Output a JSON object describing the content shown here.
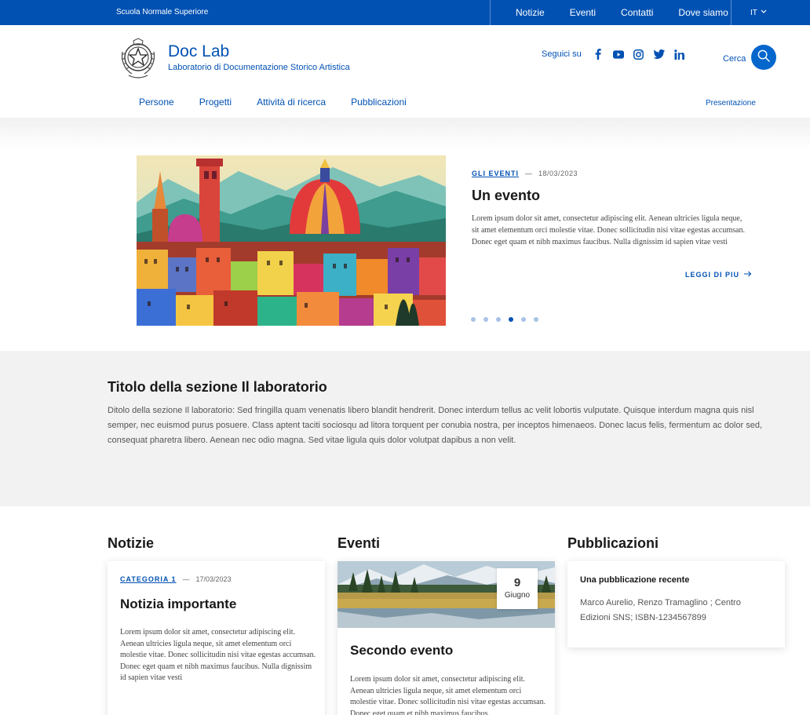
{
  "slim_header": {
    "org_name": "Scuola Normale Superiore",
    "links": [
      "Notizie",
      "Eventi",
      "Contatti",
      "Dove siamo"
    ],
    "language": "IT"
  },
  "brand": {
    "title": "Doc Lab",
    "subtitle": "Laboratorio di Documentazione Storico Artistica"
  },
  "social": {
    "label": "Seguici su",
    "icons": [
      "facebook-icon",
      "youtube-icon",
      "instagram-icon",
      "twitter-icon",
      "linkedin-icon"
    ]
  },
  "search": {
    "label": "Cerca"
  },
  "main_nav": {
    "items": [
      "Persone",
      "Progetti",
      "Attività di ricerca",
      "Pubblicazioni"
    ],
    "secondary": "Presentazione"
  },
  "hero": {
    "category": "GLI EVENTI",
    "date": "18/03/2023",
    "title": "Un evento",
    "text": "Lorem ipsum dolor sit amet, consectetur adipiscing elit. Aenean ultricies ligula neque, sit amet elementum orci molestie vitae. Donec sollicitudin nisi vitae egestas accumsan. Donec eget quam et nibh maximus faucibus. Nulla dignissim id sapien vitae vesti",
    "read_more": "LEGGI DI PIU",
    "slide_count": 6,
    "active_slide": 4
  },
  "section": {
    "title": "Titolo della sezione Il laboratorio",
    "text": "Ditolo della sezione Il laboratorio: Sed fringilla quam venenatis libero blandit hendrerit. Donec interdum tellus ac velit lobortis vulputate. Quisque interdum magna quis nisl semper, nec euismod purus posuere. Class aptent taciti sociosqu ad litora torquent per conubia nostra, per inceptos himenaeos. Donec lacus felis, fermentum ac dolor sed, consequat pharetra libero. Aenean nec odio magna. Sed vitae ligula quis dolor volutpat dapibus a non velit."
  },
  "news": {
    "heading": "Notizie",
    "category": "CATEGORIA 1",
    "date": "17/03/2023",
    "title": "Notizia importante",
    "text": "Lorem ipsum dolor sit amet, consectetur adipiscing elit. Aenean ultricies ligula neque, sit amet elementum orci molestie vitae. Donec sollicitudin nisi vitae egestas accumsan. Donec eget quam et nibh maximus faucibus. Nulla dignissim id sapien vitae vesti"
  },
  "events": {
    "heading": "Eventi",
    "day": "9",
    "month": "Giugno",
    "title": "Secondo evento",
    "text": "Lorem ipsum dolor sit amet, consectetur adipiscing elit. Aenean ultricies ligula neque, sit amet elementum orci molestie vitae. Donec sollicitudin nisi vitae egestas accumsan. Donec eget quam et nibh maximus faucibus."
  },
  "publications": {
    "heading": "Pubblicazioni",
    "title": "Una pubblicazione recente",
    "text": "Marco Aurelio, Renzo Tramaglino ; Centro Edizioni SNS; ISBN-1234567899"
  },
  "colors": {
    "primary": "#0151b3",
    "search_button": "#0566cc",
    "section_bg": "#f2f2f2"
  }
}
